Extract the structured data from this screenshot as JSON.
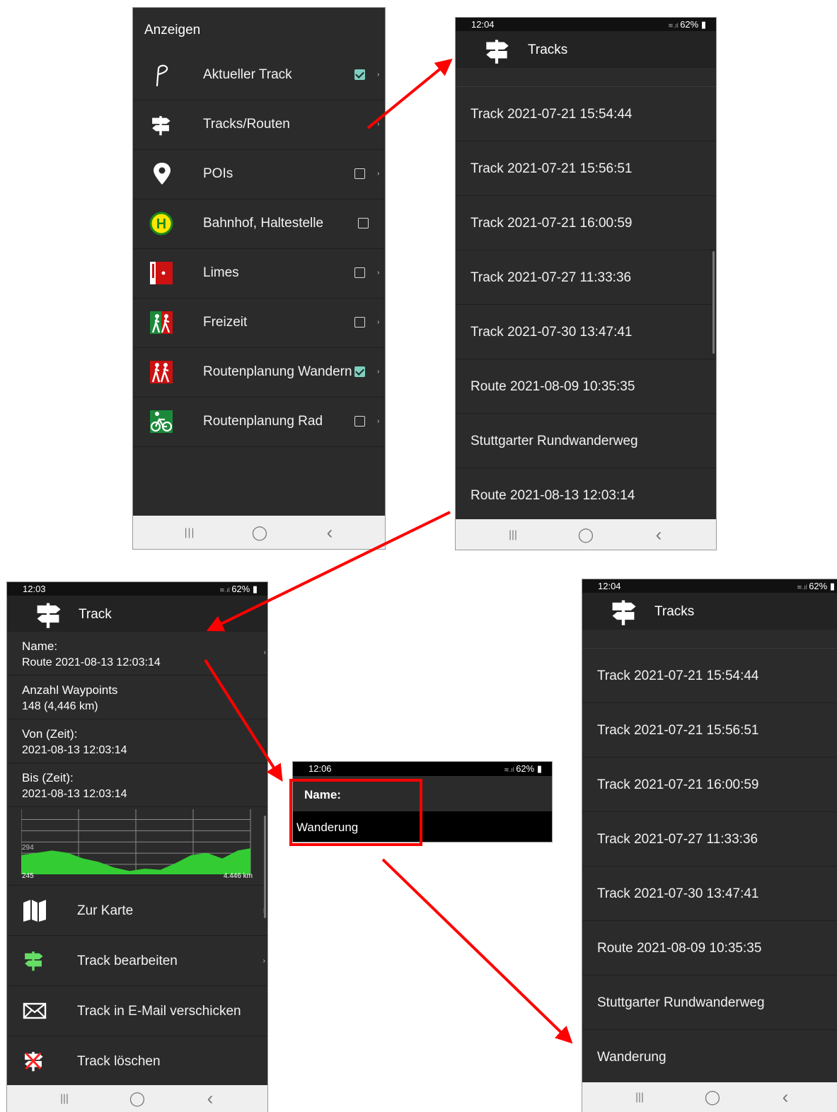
{
  "menu": {
    "title": "Anzeigen",
    "items": [
      {
        "label": "Aktueller Track",
        "icon": "track-pen-icon",
        "checked": true
      },
      {
        "label": "Tracks/Routen",
        "icon": "signpost-icon"
      },
      {
        "label": "POIs",
        "icon": "map-pin-icon",
        "checked": false
      },
      {
        "label": "Bahnhof, Haltestelle",
        "icon": "bus-stop-icon",
        "checked": false
      },
      {
        "label": "Limes",
        "icon": "limes-icon",
        "checked": false
      },
      {
        "label": "Freizeit",
        "icon": "leisure-icon",
        "checked": false
      },
      {
        "label": "Routenplanung Wandern",
        "icon": "hiking-icon",
        "checked": true
      },
      {
        "label": "Routenplanung Rad",
        "icon": "bicycle-icon",
        "checked": false
      }
    ],
    "nav": {
      "recent": "|||",
      "home": "◯",
      "back": "‹"
    }
  },
  "tracks1": {
    "time": "12:04",
    "battery": "62%",
    "title": "Tracks",
    "items": [
      "Track 2021-07-21 15:54:44",
      "Track 2021-07-21 15:56:51",
      "Track 2021-07-21 16:00:59",
      "Track 2021-07-27 11:33:36",
      "Track 2021-07-30 13:47:41",
      "Route 2021-08-09 10:35:35",
      "Stuttgarter Rundwanderweg",
      "Route 2021-08-13 12:03:14"
    ]
  },
  "track": {
    "time": "12:03",
    "battery": "62%",
    "title": "Track",
    "fields": [
      {
        "label": "Name:",
        "value": "Route 2021-08-13 12:03:14"
      },
      {
        "label": "Anzahl Waypoints",
        "value": "148 (4,446 km)"
      },
      {
        "label": "Von (Zeit):",
        "value": "2021-08-13 12:03:14"
      },
      {
        "label": "Bis (Zeit):",
        "value": "2021-08-13 12:03:14"
      }
    ],
    "chart": {
      "y_high": "294",
      "y_low": "245",
      "distance": "4.446 km"
    },
    "actions": [
      "Zur Karte",
      "Track bearbeiten",
      "Track in E-Mail verschicken",
      "Track löschen"
    ]
  },
  "chart_data": {
    "type": "area",
    "title": "",
    "xlabel": "",
    "ylabel": "",
    "ylim": [
      245,
      300
    ],
    "xlim": [
      0,
      4.446
    ],
    "y_tick_labels": [
      "294",
      "245"
    ],
    "x_end_label": "4.446 km",
    "x": [
      0,
      0.3,
      0.6,
      0.9,
      1.2,
      1.5,
      1.8,
      2.1,
      2.4,
      2.7,
      3.0,
      3.3,
      3.6,
      3.9,
      4.2,
      4.446
    ],
    "values": [
      262,
      264,
      266,
      264,
      259,
      256,
      251,
      248,
      250,
      249,
      255,
      262,
      264,
      259,
      266,
      268
    ],
    "color": "#33cc33"
  },
  "dialog": {
    "time": "12:06",
    "battery": "62%",
    "title": "Name:",
    "value": "Wanderung"
  },
  "tracks2": {
    "time": "12:04",
    "battery": "62%",
    "title": "Tracks",
    "items": [
      "Track 2021-07-21 15:54:44",
      "Track 2021-07-21 15:56:51",
      "Track 2021-07-21 16:00:59",
      "Track 2021-07-27 11:33:36",
      "Track 2021-07-30 13:47:41",
      "Route 2021-08-09 10:35:35",
      "Stuttgarter Rundwanderweg",
      "Wanderung"
    ]
  },
  "colors": {
    "highlight": "#ff0000",
    "arrow": "#ff0000",
    "check": "#7ecfc0",
    "elevation": "#33cc33"
  }
}
